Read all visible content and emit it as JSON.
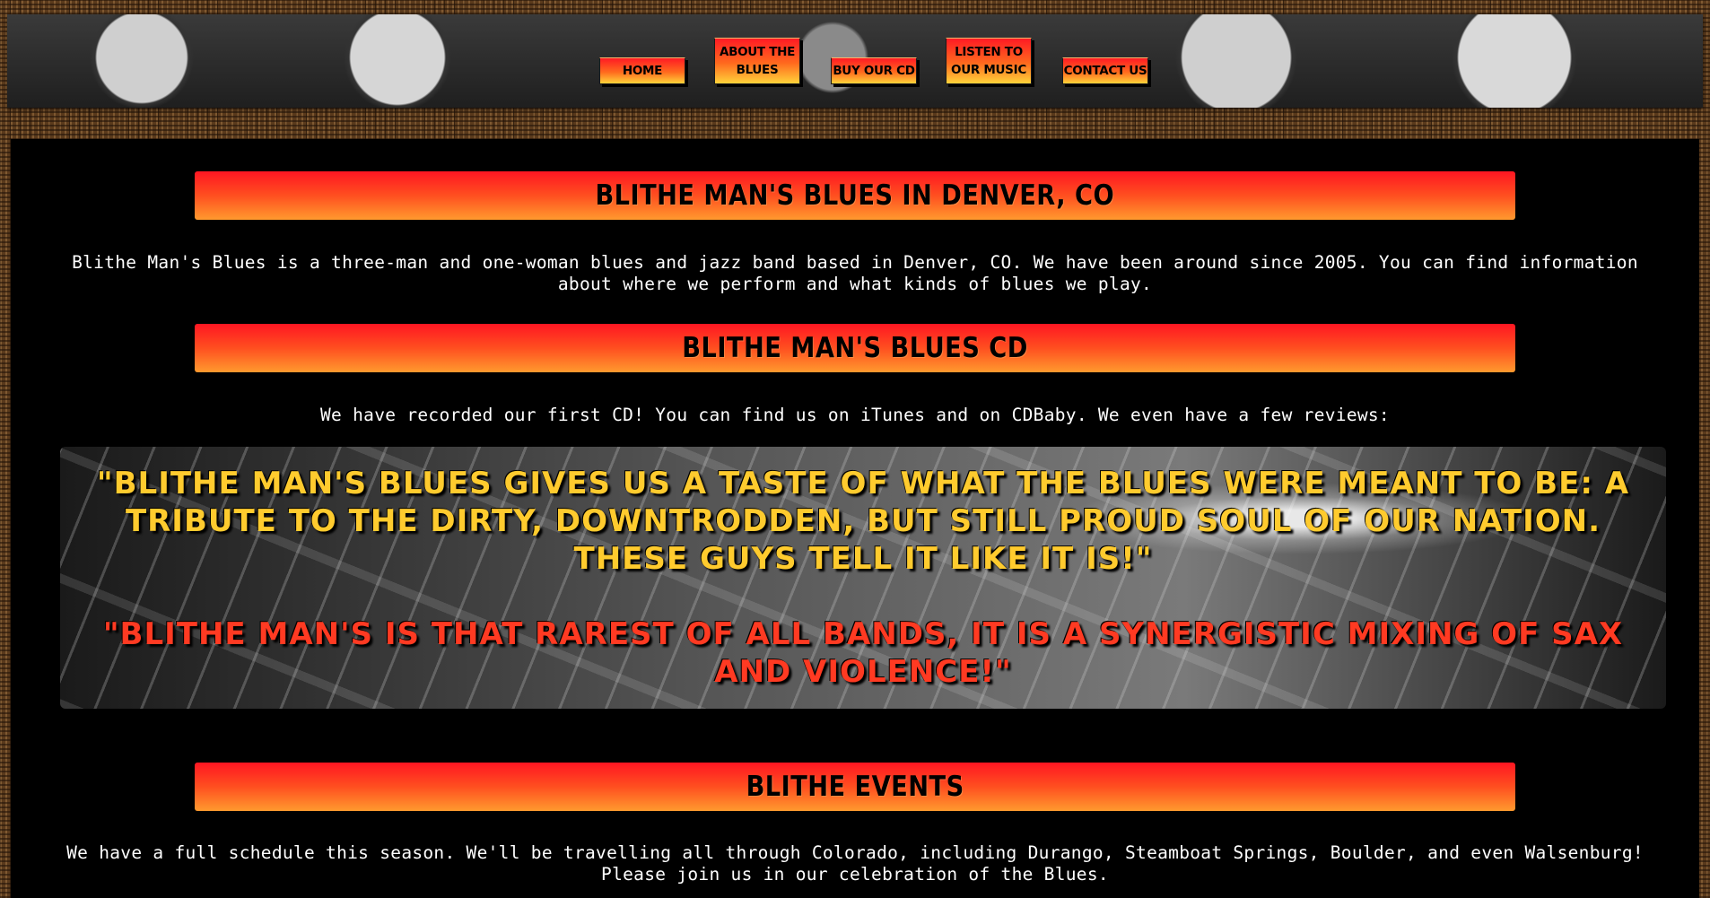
{
  "nav": {
    "home": "HOME",
    "about_line1": "ABOUT THE",
    "about_line2": "BLUES",
    "buy": "BUY OUR CD",
    "listen_line1": "LISTEN TO",
    "listen_line2": "OUR MUSIC",
    "contact": "CONTACT US"
  },
  "sections": {
    "intro": {
      "heading": "BLITHE MAN'S BLUES IN DENVER, CO",
      "text": "Blithe Man's Blues is a three-man and one-woman blues and jazz band based in Denver, CO. We have been around since 2005. You can find information about where we perform and what kinds of blues we play."
    },
    "cd": {
      "heading": "BLITHE MAN'S BLUES CD",
      "text": "We have recorded our first CD! You can find us on iTunes and on CDBaby. We even have a few reviews:"
    },
    "reviews": [
      "\"BLITHE MAN'S BLUES GIVES US A TASTE OF WHAT THE BLUES WERE MEANT TO BE: A TRIBUTE TO THE DIRTY, DOWNTRODDEN, BUT STILL PROUD SOUL OF OUR NATION. THESE GUYS TELL IT LIKE IT IS!\"",
      "\"BLITHE MAN'S IS THAT RAREST OF ALL BANDS, IT IS A SYNERGISTIC MIXING OF SAX AND VIOLENCE!\""
    ],
    "events": {
      "heading": "BLITHE EVENTS",
      "text": "We have a full schedule this season. We'll be travelling all through Colorado, including Durango, Steamboat Springs, Boulder, and even Walsenburg! Please join us in our celebration of the Blues."
    }
  },
  "colors": {
    "accent_red": "#ff1622",
    "accent_orange": "#ff9a2e",
    "review_yellow": "#ffcb2e",
    "review_red": "#ff3a22"
  }
}
